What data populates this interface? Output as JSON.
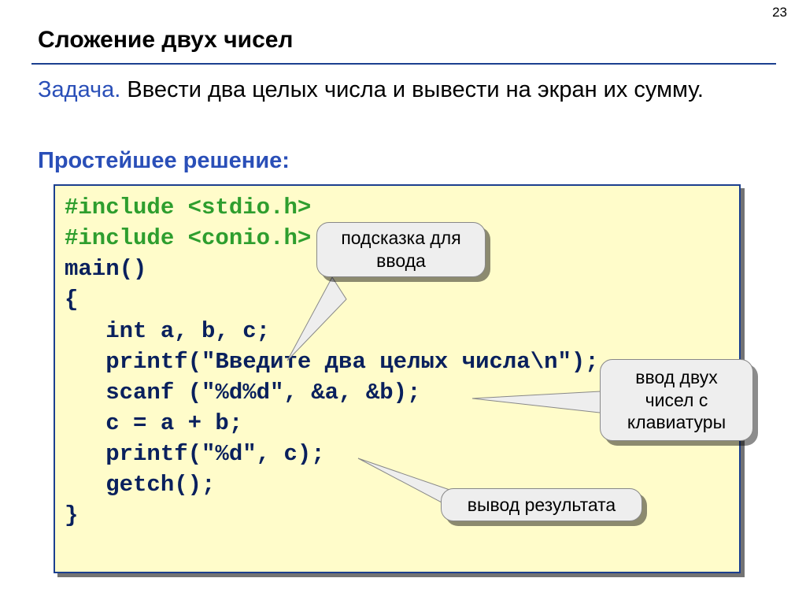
{
  "page_number": "23",
  "title": "Сложение двух чисел",
  "problem_label": "Задача.",
  "problem_text": "Ввести два целых числа и вывести на экран их сумму.",
  "solution_label": "Простейшее решение:",
  "code": {
    "l1": "#include <stdio.h>",
    "l2": "#include <conio.h>",
    "l3": "main()",
    "l4": "{",
    "l5": "   int a, b, c;",
    "l6": "   printf(\"Введите два целых числа\\n\");",
    "l7": "   scanf (\"%d%d\", &a, &b);",
    "l8": "   c = a + b;",
    "l9": "   printf(\"%d\", c);",
    "l10": "   getch();",
    "l11": "}"
  },
  "callouts": {
    "hint": "подсказка для\nввода",
    "input": "ввод двух\nчисел с\nклавиатуры",
    "output": "вывод результата"
  }
}
